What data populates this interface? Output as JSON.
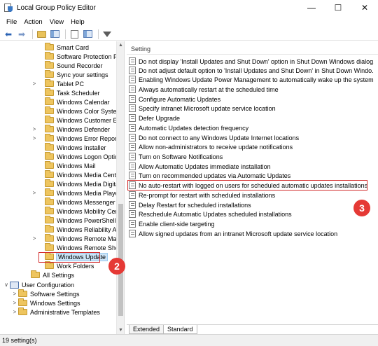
{
  "window": {
    "title": "Local Group Policy Editor",
    "controls": {
      "minimize": "—",
      "maximize": "☐",
      "close": "✕"
    }
  },
  "menu": [
    "File",
    "Action",
    "View",
    "Help"
  ],
  "toolbar": {
    "icons": [
      "back-arrow-icon",
      "forward-arrow-icon",
      "up-folder-icon",
      "show-hide-tree-icon",
      "export-list-icon",
      "properties-icon",
      "filter-icon"
    ]
  },
  "tree": {
    "items": [
      {
        "label": "Smart Card",
        "expander": ""
      },
      {
        "label": "Software Protection Plat",
        "expander": ""
      },
      {
        "label": "Sound Recorder",
        "expander": ""
      },
      {
        "label": "Sync your settings",
        "expander": ""
      },
      {
        "label": "Tablet PC",
        "expander": ">"
      },
      {
        "label": "Task Scheduler",
        "expander": ""
      },
      {
        "label": "Windows Calendar",
        "expander": ""
      },
      {
        "label": "Windows Color System",
        "expander": ""
      },
      {
        "label": "Windows Customer Exp",
        "expander": ""
      },
      {
        "label": "Windows Defender",
        "expander": ">"
      },
      {
        "label": "Windows Error Reportin",
        "expander": ">"
      },
      {
        "label": "Windows Installer",
        "expander": ""
      },
      {
        "label": "Windows Logon Option",
        "expander": ""
      },
      {
        "label": "Windows Mail",
        "expander": ""
      },
      {
        "label": "Windows Media Center",
        "expander": ""
      },
      {
        "label": "Windows Media Digital",
        "expander": ""
      },
      {
        "label": "Windows Media Player",
        "expander": ">"
      },
      {
        "label": "Windows Messenger",
        "expander": ""
      },
      {
        "label": "Windows Mobility Cent",
        "expander": ""
      },
      {
        "label": "Windows PowerShell",
        "expander": ""
      },
      {
        "label": "Windows Reliability Ana",
        "expander": ""
      },
      {
        "label": "Windows Remote Mana",
        "expander": ">"
      },
      {
        "label": "Windows Remote Shell",
        "expander": ""
      },
      {
        "label": "Windows Update",
        "expander": "",
        "selected": true
      },
      {
        "label": "Work Folders",
        "expander": ""
      }
    ],
    "all_settings": "All Settings",
    "user_configuration": "User Configuration",
    "user_children": [
      {
        "label": "Software Settings",
        "expander": ">"
      },
      {
        "label": "Windows Settings",
        "expander": ">"
      },
      {
        "label": "Administrative Templates",
        "expander": ">"
      }
    ]
  },
  "details": {
    "column_header": "Setting",
    "policies": [
      "Do not display 'Install Updates and Shut Down' option in Shut Down Windows dialog...",
      "Do not adjust default option to 'Install Updates and Shut Down' in Shut Down Windo...",
      "Enabling Windows Update Power Management to automatically wake up the system ...",
      "Always automatically restart at the scheduled time",
      "Configure Automatic Updates",
      "Specify intranet Microsoft update service location",
      "Defer Upgrade",
      "Automatic Updates detection frequency",
      "Do not connect to any Windows Update Internet locations",
      "Allow non-administrators to receive update notifications",
      "Turn on Software Notifications",
      "Allow Automatic Updates immediate installation",
      "Turn on recommended updates via Automatic Updates",
      "No auto-restart with logged on users for scheduled automatic updates installations",
      "Re-prompt for restart with scheduled installations",
      "Delay Restart for scheduled installations",
      "Reschedule Automatic Updates scheduled installations",
      "Enable client-side targeting",
      "Allow signed updates from an intranet Microsoft update service location"
    ],
    "tabs": [
      "Extended",
      "Standard"
    ],
    "active_tab": "Standard"
  },
  "annotations": {
    "step2": "2",
    "step3": "3",
    "color": "#e53935"
  },
  "status": "19 setting(s)"
}
